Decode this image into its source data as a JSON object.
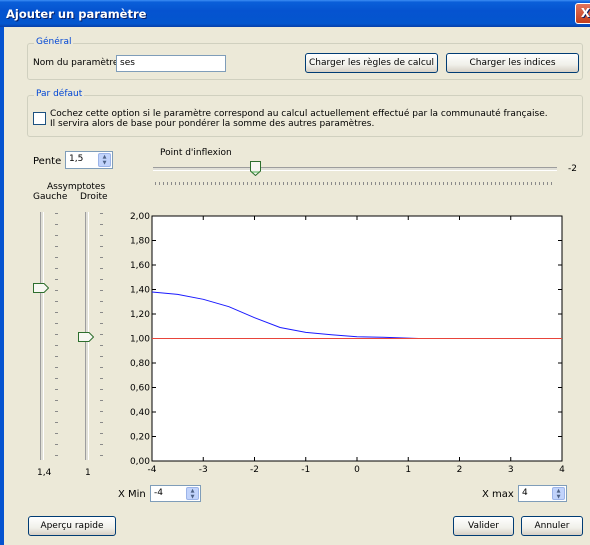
{
  "window": {
    "title": "Ajouter un paramètre",
    "close_glyph": "X"
  },
  "general": {
    "legend": "Général",
    "name_label": "Nom du paramètre :",
    "name_value": "ses",
    "load_rules_button": "Charger les règles de calcul",
    "load_indices_button": "Charger les indices"
  },
  "default": {
    "legend": "Par défaut",
    "checkbox_checked": false,
    "description_line1": "Cochez cette option si le paramètre correspond au calcul actuellement effectué par la communauté française.",
    "description_line2": "Il servira alors de base pour pondérer la somme des autres paramètres."
  },
  "curve": {
    "pente_label": "Pente",
    "pente_value": "1,5",
    "inflexion_label": "Point d'inflexion",
    "inflexion_value": "-2",
    "asymptotes_label": "Assymptotes",
    "gauche_label": "Gauche",
    "droite_label": "Droite",
    "gauche_value": "1,4",
    "droite_value": "1"
  },
  "range": {
    "xmin_label": "X Min :",
    "xmin_value": "-4",
    "xmax_label": "X max :",
    "xmax_value": "4"
  },
  "footer": {
    "preview_button": "Aperçu rapide",
    "validate_button": "Valider",
    "cancel_button": "Annuler"
  },
  "colors": {
    "curve": "#1a1aff",
    "reference_line": "#e8443a",
    "titlebar": "#0553d0"
  },
  "chart_data": {
    "type": "line",
    "xlim": [
      -4,
      4
    ],
    "ylim": [
      0,
      2
    ],
    "x_ticks": [
      "-4",
      "-3",
      "-2",
      "-1",
      "0",
      "1",
      "2",
      "3",
      "4"
    ],
    "y_ticks": [
      "0,00",
      "0,20",
      "0,40",
      "0,60",
      "0,80",
      "1,00",
      "1,20",
      "1,40",
      "1,60",
      "1,80",
      "2,00"
    ],
    "grid": false,
    "series": [
      {
        "color": "#1a1aff",
        "x": [
          -4,
          -3.5,
          -3,
          -2.5,
          -2,
          -1.5,
          -1,
          -0.5,
          0,
          0.5,
          1.2
        ],
        "y": [
          1.38,
          1.36,
          1.32,
          1.26,
          1.17,
          1.09,
          1.05,
          1.03,
          1.015,
          1.01,
          1.0
        ]
      },
      {
        "color": "#e8443a",
        "x": [
          -4,
          4
        ],
        "y": [
          1.0,
          1.0
        ]
      }
    ]
  }
}
